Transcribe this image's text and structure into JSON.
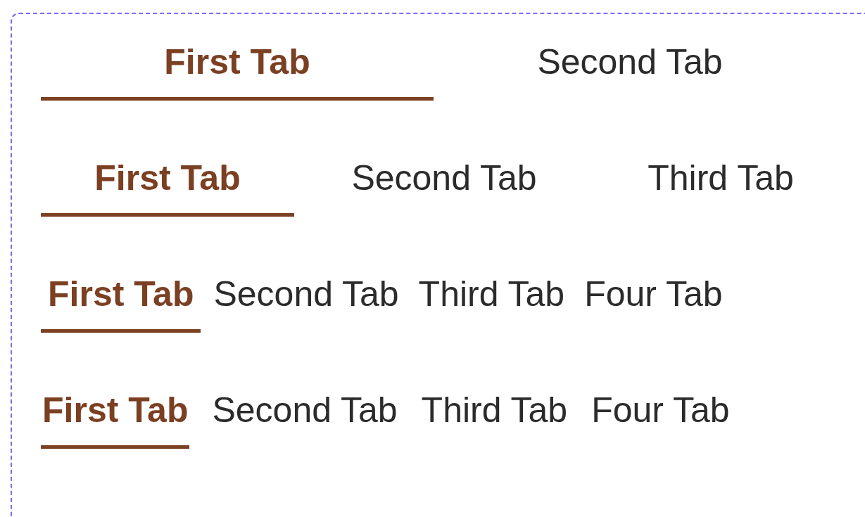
{
  "tab_bars": [
    {
      "tabs": [
        {
          "label": "First Tab",
          "selected": true
        },
        {
          "label": "Second Tab",
          "selected": false
        }
      ]
    },
    {
      "tabs": [
        {
          "label": "First Tab",
          "selected": true
        },
        {
          "label": "Second Tab",
          "selected": false
        },
        {
          "label": "Third Tab",
          "selected": false
        }
      ]
    },
    {
      "tabs": [
        {
          "label": "First Tab",
          "selected": true
        },
        {
          "label": "Second Tab",
          "selected": false
        },
        {
          "label": "Third Tab",
          "selected": false
        },
        {
          "label": "Four Tab",
          "selected": false
        }
      ]
    },
    {
      "tabs": [
        {
          "label": "First Tab",
          "selected": true
        },
        {
          "label": "Second Tab",
          "selected": false
        },
        {
          "label": "Third Tab",
          "selected": false
        },
        {
          "label": "Four Tab",
          "selected": false
        }
      ]
    }
  ]
}
